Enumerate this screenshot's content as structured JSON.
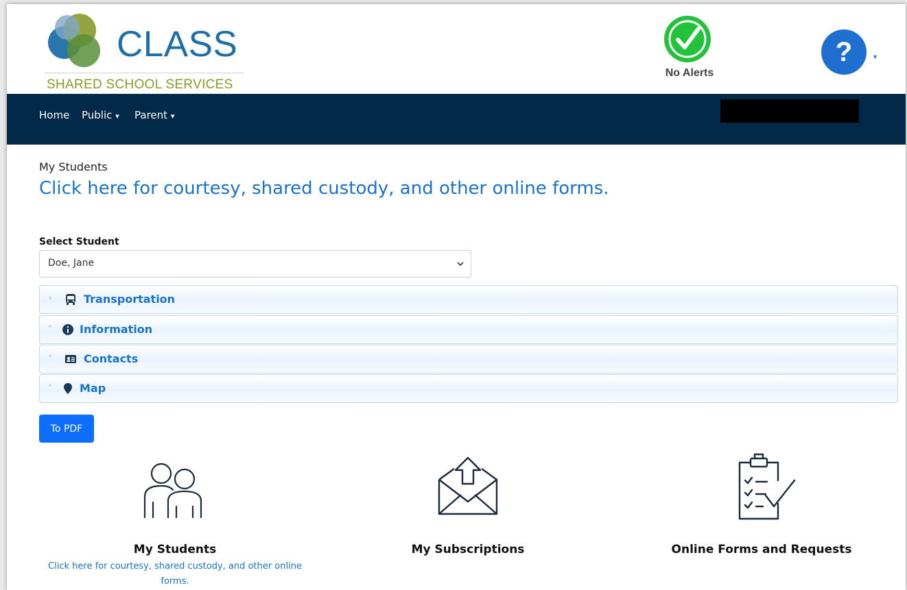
{
  "header": {
    "logo_word": "CLASS",
    "logo_subtitle": "SHARED SCHOOL SERVICES",
    "alerts_label": "No Alerts",
    "help_symbol": "?"
  },
  "nav": {
    "items": [
      "Home",
      "Public",
      "Parent"
    ],
    "caret": "▾"
  },
  "main": {
    "section_label": "My Students",
    "forms_link": "Click here for courtesy, shared custody, and other online forms.",
    "select_label": "Select Student",
    "selected_student": "Doe, Jane",
    "accordion": [
      {
        "title": "Transportation",
        "icon": "bus-icon",
        "caret": "›",
        "expanded": false
      },
      {
        "title": "Information",
        "icon": "info-circle-icon",
        "caret": "^",
        "expanded": true
      },
      {
        "title": "Contacts",
        "icon": "contact-card-icon",
        "caret": "^",
        "expanded": true
      },
      {
        "title": "Map",
        "icon": "map-pin-icon",
        "caret": "^",
        "expanded": true
      }
    ],
    "pdf_button": "To PDF"
  },
  "cards": [
    {
      "title": "My Students",
      "icon": "students-icon",
      "link": "Click here for courtesy, shared custody, and other online forms."
    },
    {
      "title": "My Subscriptions",
      "icon": "envelope-icon"
    },
    {
      "title": "Online Forms and Requests",
      "icon": "clipboard-checklist-icon"
    }
  ],
  "colors": {
    "navbar": "#032948",
    "link": "#1a73c9",
    "button": "#0d6efd",
    "alert_green": "#22c23a",
    "help_blue": "#1f6fd1",
    "logo_blue": "#1e6fa8",
    "logo_olive": "#8a9a2a"
  }
}
